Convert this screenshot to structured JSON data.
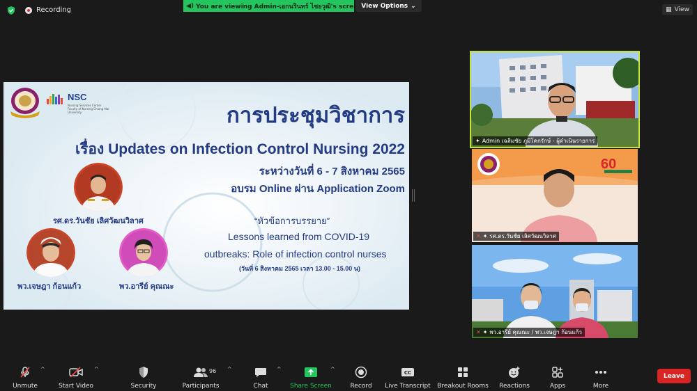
{
  "topbar": {
    "recording_label": "Recording",
    "viewing_text": "You are viewing Admin-เอกนรินทร์ ไชยวุฒิ's screen",
    "view_options_label": "View Options",
    "view_label": "View"
  },
  "slide": {
    "nsc_label": "NSC",
    "nsc_sub": "Nursing Services Center Faculty of Nursing Chiang Mai University",
    "title": "การประชุมวิชาการ",
    "topic": "เรื่อง Updates on Infection Control Nursing 2022",
    "dates": "ระหว่างวันที่ 6 - 7 สิงหาคม 2565",
    "online": "อบรม Online ผ่าน Application Zoom",
    "lecture_heading": "“หัวข้อการบรรยาย”",
    "lecture_line1": "Lessons learned from COVID-19",
    "lecture_line2": "outbreaks: Role of infection control nurses",
    "lecture_time": "(วันที่ 6 สิงหาคม 2565 เวลา 13.00 - 15.00 น)",
    "speaker1": "รศ.ดร.วันชัย เลิศวัฒนวิลาศ",
    "speaker2": "พว.เจษฎา ก้อนแก้ว",
    "speaker3": "พว.อารีย์ คุณณะ"
  },
  "tiles": [
    {
      "name": "Admin เฉลิมชัย ภูมิโคกรักษ์ - ผู้ดำเนินรายการ"
    },
    {
      "name": "รศ.ดร.วันชัย เลิศวัฒนวิลาศ"
    },
    {
      "name": "พว.อารีย์ คุณณะ / พว.เจษฎา ก้อนแก้ว"
    }
  ],
  "toolbar": {
    "unmute": "Unmute",
    "start_video": "Start Video",
    "security": "Security",
    "participants": "Participants",
    "participants_count": "96",
    "chat": "Chat",
    "share_screen": "Share Screen",
    "record": "Record",
    "live_transcript": "Live Transcript",
    "breakout_rooms": "Breakout Rooms",
    "reactions": "Reactions",
    "apps": "Apps",
    "more": "More",
    "leave": "Leave",
    "cc_label": "CC"
  },
  "colors": {
    "accent_green": "#22c55e",
    "leave_red": "#d92424",
    "slide_blue": "#233a84",
    "active_speaker": "#c6e33a"
  }
}
